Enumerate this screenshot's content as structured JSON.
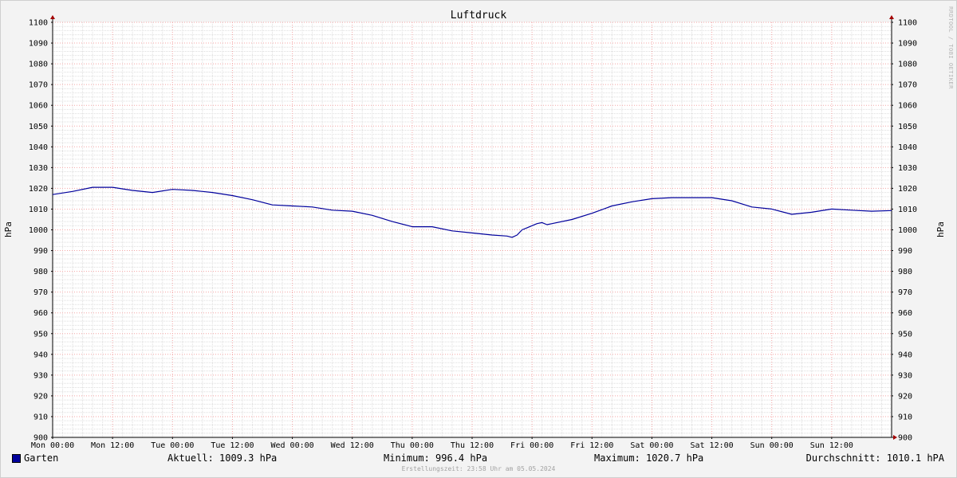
{
  "chart_data": {
    "type": "line",
    "title": "Luftdruck",
    "ylabel_left": "hPa",
    "ylabel_right": "hPa",
    "watermark": "RRDTOOL / TOBI OETIKER",
    "ylim": [
      900,
      1100
    ],
    "y_ticks": [
      900,
      910,
      920,
      930,
      940,
      950,
      960,
      970,
      980,
      990,
      1000,
      1010,
      1020,
      1030,
      1040,
      1050,
      1060,
      1070,
      1080,
      1090,
      1100
    ],
    "y_tick_labels": [
      "900",
      "910",
      "920",
      "930",
      "940",
      "950",
      "960",
      "970",
      "980",
      "990",
      "1000",
      "1010",
      "1020",
      "1030",
      "1040",
      "1050",
      "1060",
      "1070",
      "1080",
      "1090",
      "1100"
    ],
    "x_range_hours": [
      0,
      168
    ],
    "x_ticks": [
      {
        "hour": 0,
        "label": "Mon 00:00"
      },
      {
        "hour": 12,
        "label": "Mon 12:00"
      },
      {
        "hour": 24,
        "label": "Tue 00:00"
      },
      {
        "hour": 36,
        "label": "Tue 12:00"
      },
      {
        "hour": 48,
        "label": "Wed 00:00"
      },
      {
        "hour": 60,
        "label": "Wed 12:00"
      },
      {
        "hour": 72,
        "label": "Thu 00:00"
      },
      {
        "hour": 84,
        "label": "Thu 12:00"
      },
      {
        "hour": 96,
        "label": "Fri 00:00"
      },
      {
        "hour": 108,
        "label": "Fri 12:00"
      },
      {
        "hour": 120,
        "label": "Sat 00:00"
      },
      {
        "hour": 132,
        "label": "Sat 12:00"
      },
      {
        "hour": 144,
        "label": "Sun 00:00"
      },
      {
        "hour": 156,
        "label": "Sun 12:00"
      }
    ],
    "grid": true,
    "series": [
      {
        "name": "Garten",
        "color": "#00009c",
        "x_hours": [
          0,
          4,
          8,
          12,
          16,
          20,
          24,
          28,
          32,
          36,
          40,
          44,
          48,
          52,
          56,
          60,
          64,
          68,
          72,
          76,
          80,
          84,
          88,
          91,
          92,
          93,
          94,
          95,
          96,
          97,
          98,
          99,
          100,
          104,
          108,
          112,
          116,
          120,
          124,
          128,
          132,
          136,
          140,
          144,
          148,
          152,
          156,
          160,
          164,
          168
        ],
        "values": [
          1017,
          1018.5,
          1020.5,
          1020.5,
          1019,
          1018,
          1019.5,
          1019,
          1018,
          1016.5,
          1014.5,
          1012,
          1011.5,
          1011,
          1009.5,
          1009,
          1007,
          1004,
          1001.5,
          1001.5,
          999.5,
          998.5,
          997.5,
          997,
          996.4,
          997.5,
          1000,
          1001,
          1002,
          1003,
          1003.5,
          1002.5,
          1003,
          1005,
          1008,
          1011.5,
          1013.5,
          1015,
          1015.5,
          1015.5,
          1015.5,
          1014,
          1011,
          1010,
          1007.5,
          1008.5,
          1010,
          1009.5,
          1009,
          1009.3
        ]
      }
    ],
    "legend_placement": "bottom-left"
  },
  "legend": {
    "series_name": "Garten",
    "aktuell": "Aktuell: 1009.3 hPa",
    "minimum": "Minimum: 996.4 hPa",
    "maximum": "Maximum: 1020.7 hPa",
    "durchschnitt": "Durchschnitt: 1010.1 hPA",
    "swatch_color": "#00009c"
  },
  "footer": {
    "created": "Erstellungszeit: 23:58 Uhr am 05.05.2024"
  }
}
